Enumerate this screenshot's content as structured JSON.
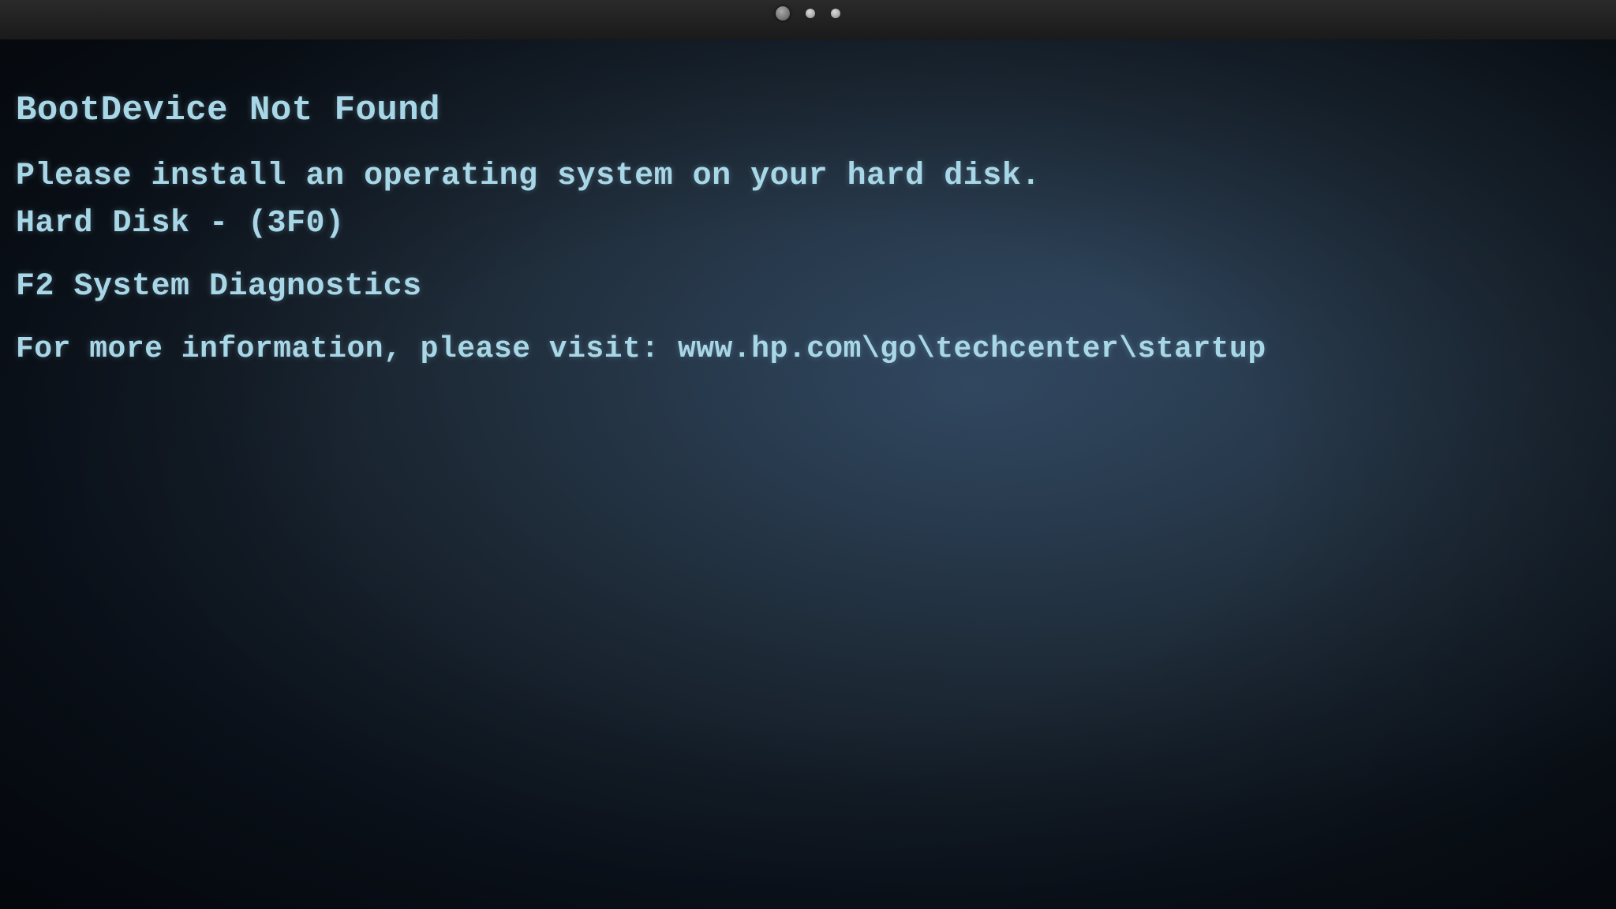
{
  "screen": {
    "background_color": "#0d1520",
    "accent_color": "#a8d8e8"
  },
  "bezel": {
    "background": "#1e1e1e"
  },
  "content": {
    "line1": "BootDevice Not Found",
    "line2": "Please install an operating system on your hard disk.",
    "line3": "Hard Disk - (3F0)",
    "line4": "F2 System Diagnostics",
    "line5_prefix": "For more information, please visit: ",
    "line5_url": "www.hp.com\\go\\techcenter\\startup"
  }
}
